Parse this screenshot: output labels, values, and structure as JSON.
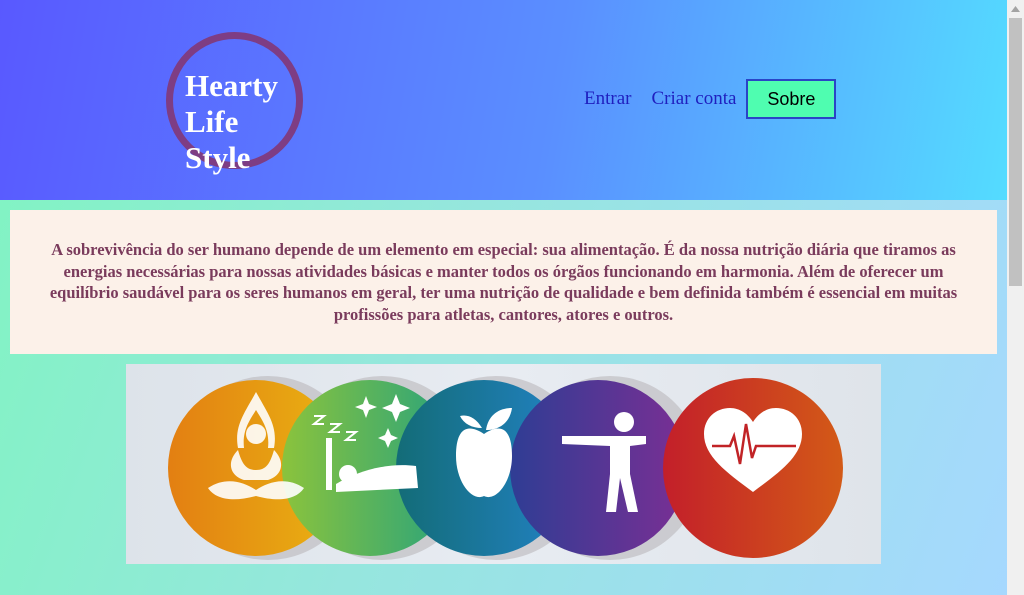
{
  "header": {
    "logo": {
      "line1": "Hearty",
      "line2": "Life",
      "line3": "Style"
    },
    "nav": {
      "login": "Entrar",
      "signup": "Criar conta",
      "about": "Sobre"
    }
  },
  "intro": {
    "text": "A sobrevivência do ser humano depende de um elemento em especial: sua alimentação. É da nossa nutrição diária que tiramos as energias necessárias para nossas atividades básicas e manter todos os órgãos funcionando em harmonia. Além de oferecer um equilíbrio saudável para os seres humanos em geral, ter uma nutrição de qualidade e bem definida também é essencial em muitas profissões para atletas, cantores, atores e outros."
  },
  "banner": {
    "icons": [
      "yoga-icon",
      "sleep-icon",
      "apple-icon",
      "fitness-icon",
      "heart-rate-icon"
    ]
  },
  "colors": {
    "logo_ring": "#7e3d84",
    "nav_link": "#1f1fbf",
    "about_button": "#4ffdb0",
    "intro_text": "#7a3b5c",
    "intro_background": "#fcf1e9"
  }
}
